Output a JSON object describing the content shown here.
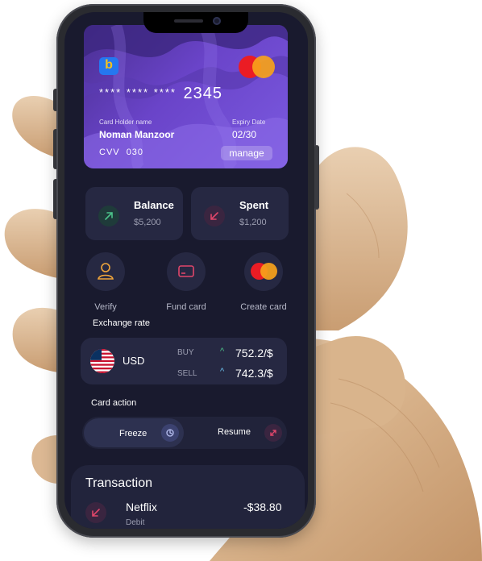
{
  "card": {
    "brand_letter": "b",
    "number_masked": "**** **** ****",
    "number_last4": "2345",
    "holder_label": "Card Holder name",
    "holder_name": "Noman Manzoor",
    "expiry_label": "Expiry Date",
    "expiry_value": "02/30",
    "cvv_label": "CVV",
    "cvv_value": "030",
    "manage_label": "manage",
    "network_icon": "mastercard-icon"
  },
  "stats": [
    {
      "title": "Balance",
      "value": "$5,200",
      "icon": "arrow-up-right-icon",
      "icon_color": "#4cc38a"
    },
    {
      "title": "Spent",
      "value": "$1,200",
      "icon": "arrow-down-left-icon",
      "icon_color": "#e0466a"
    }
  ],
  "actions": [
    {
      "label": "Verify",
      "icon": "user-icon"
    },
    {
      "label": "Fund card",
      "icon": "card-icon"
    },
    {
      "label": "Create card",
      "icon": "mastercard-icon"
    }
  ],
  "exchange": {
    "heading": "Exchange rate",
    "currency": "USD",
    "buy_label": "BUY",
    "buy_rate": "752.2/$",
    "sell_label": "SELL",
    "sell_rate": "742.3/$"
  },
  "card_action": {
    "heading": "Card action",
    "freeze_label": "Freeze",
    "resume_label": "Resume",
    "active": "Freeze"
  },
  "transactions": {
    "heading": "Transaction",
    "items": [
      {
        "name": "Netflix",
        "type": "Debit",
        "amount": "-$38.80"
      }
    ]
  },
  "colors": {
    "screen_bg": "#191a2e",
    "tile_bg": "#262842",
    "card_gradient_start": "#4a2f92",
    "card_gradient_end": "#7b5ae0",
    "positive": "#4cc38a",
    "negative": "#e0466a"
  }
}
